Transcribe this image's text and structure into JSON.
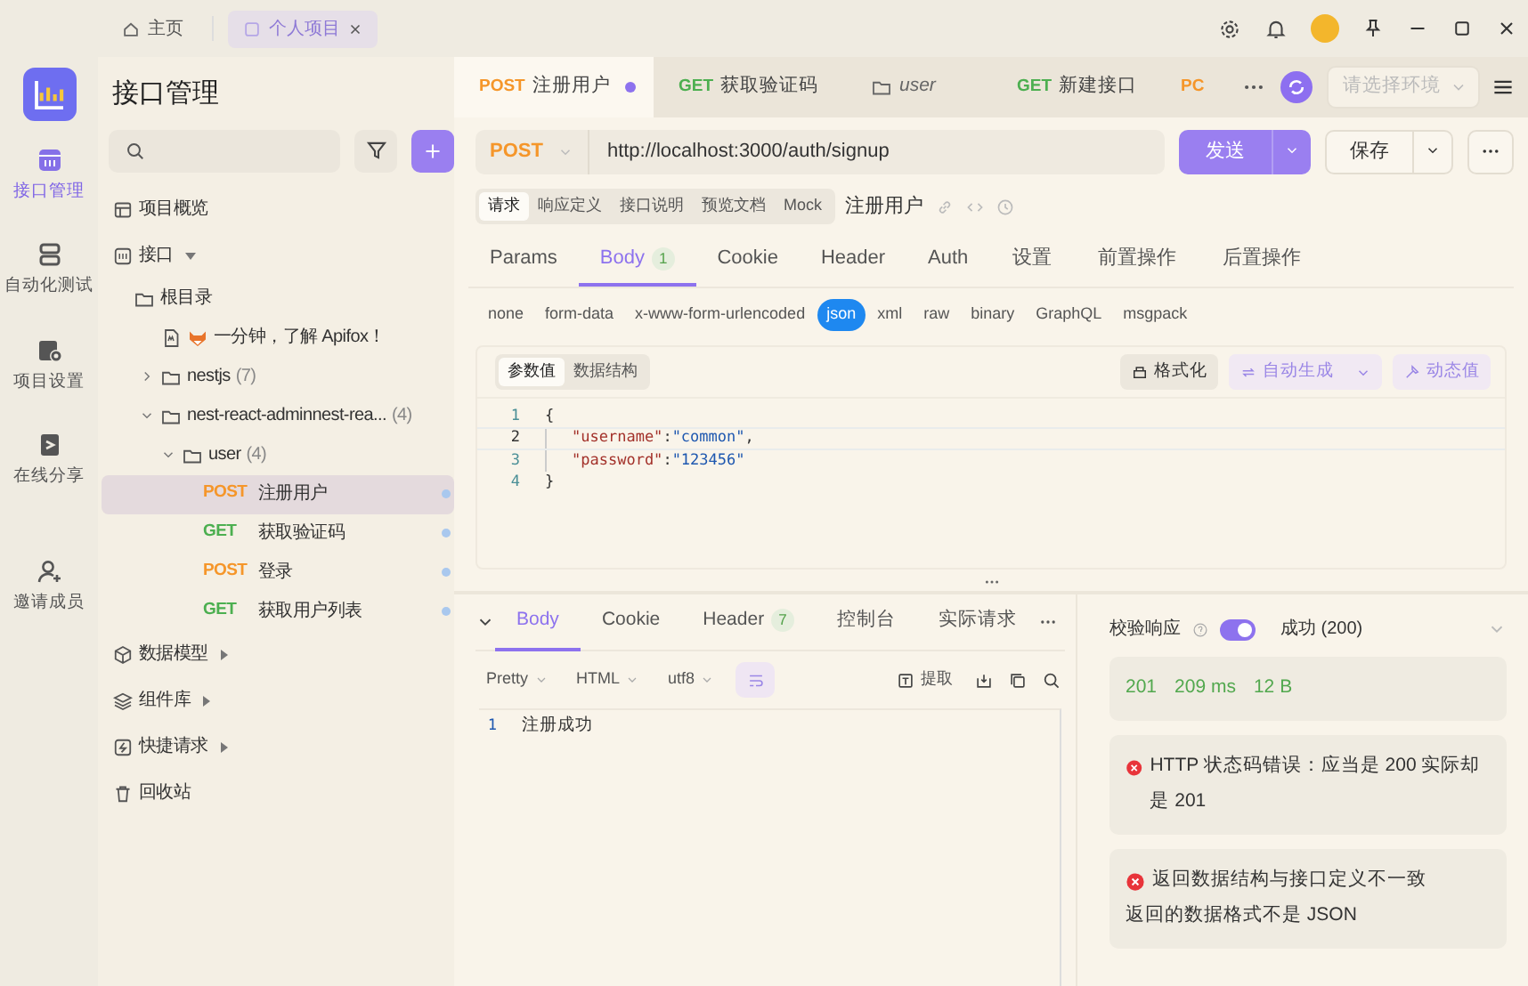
{
  "titlebar": {
    "tabs": [
      {
        "label": "主页",
        "kind": "home",
        "selected": false
      },
      {
        "label": "个人项目",
        "kind": "project",
        "selected": true
      }
    ]
  },
  "rail": [
    {
      "label": "接口管理",
      "kind": "api",
      "selected": true
    },
    {
      "label": "自动化测试",
      "kind": "test",
      "selected": false
    },
    {
      "label": "项目设置",
      "kind": "settings",
      "selected": false
    },
    {
      "label": "在线分享",
      "kind": "share",
      "selected": false
    },
    {
      "label": "邀请成员",
      "kind": "invite",
      "selected": false
    }
  ],
  "sidebar": {
    "title": "接口管理",
    "items": [
      {
        "label": "项目概览",
        "kind": "overview"
      },
      {
        "label": "接口",
        "kind": "api",
        "expanded": true,
        "children": [
          {
            "label": "根目录",
            "kind": "folder",
            "children": [
              {
                "label": "一分钟，了解 Apifox！",
                "kind": "doc"
              },
              {
                "label": "nestjs",
                "count": "(7)",
                "kind": "folder",
                "expanded": false
              },
              {
                "label": "nest-react-adminnest-rea...",
                "count": "(4)",
                "kind": "folder",
                "expanded": true,
                "children": [
                  {
                    "label": "user",
                    "count": "(4)",
                    "kind": "folder",
                    "expanded": true,
                    "children": [
                      {
                        "kind": "endpoint",
                        "method": "POST",
                        "color": "#f5962a",
                        "label": "注册用户",
                        "selected": true
                      },
                      {
                        "kind": "endpoint",
                        "method": "GET",
                        "color": "#4caf50",
                        "label": "获取验证码",
                        "selected": false
                      },
                      {
                        "kind": "endpoint",
                        "method": "POST",
                        "color": "#f5962a",
                        "label": "登录",
                        "selected": false
                      },
                      {
                        "kind": "endpoint",
                        "method": "GET",
                        "color": "#4caf50",
                        "label": "获取用户列表",
                        "selected": false
                      }
                    ]
                  }
                ]
              }
            ]
          }
        ]
      },
      {
        "label": "数据模型",
        "kind": "model",
        "expanded": false
      },
      {
        "label": "组件库",
        "kind": "components",
        "expanded": false
      },
      {
        "label": "快捷请求",
        "kind": "quick",
        "expanded": false
      },
      {
        "label": "回收站",
        "kind": "trash"
      }
    ]
  },
  "tabs": [
    {
      "method": "POST",
      "color": "#f5962a",
      "label": "注册用户",
      "selected": true,
      "modified": true
    },
    {
      "method": "GET",
      "color": "#4caf50",
      "label": "获取验证码",
      "selected": false,
      "modified": false
    },
    {
      "kind": "folder",
      "label": "user",
      "selected": false,
      "modified": false
    },
    {
      "method": "GET",
      "color": "#4caf50",
      "label": "新建接口",
      "selected": false,
      "modified": false
    },
    {
      "method": "PC",
      "color": "#f5962a",
      "selected": false,
      "modified": false
    }
  ],
  "environment": {
    "placeholder": "请选择环境"
  },
  "request": {
    "method": "POST",
    "url": "http://localhost:3000/auth/signup",
    "send": "发送",
    "save": "保存"
  },
  "sections": [
    {
      "label": "请求",
      "selected": true
    },
    {
      "label": "响应定义",
      "selected": false
    },
    {
      "label": "接口说明",
      "selected": false
    },
    {
      "label": "预览文档",
      "selected": false
    },
    {
      "label": "Mock",
      "selected": false
    }
  ],
  "endpoint_name": "注册用户",
  "param_tabs": [
    {
      "label": "Params",
      "selected": false
    },
    {
      "label": "Body",
      "badge": "1",
      "selected": true
    },
    {
      "label": "Cookie",
      "selected": false
    },
    {
      "label": "Header",
      "selected": false
    },
    {
      "label": "Auth",
      "selected": false
    },
    {
      "label": "设置",
      "selected": false
    },
    {
      "label": "前置操作",
      "selected": false
    },
    {
      "label": "后置操作",
      "selected": false
    }
  ],
  "body_types": [
    {
      "label": "none",
      "selected": false
    },
    {
      "label": "form-data",
      "selected": false
    },
    {
      "label": "x-www-form-urlencoded",
      "selected": false
    },
    {
      "label": "json",
      "selected": true
    },
    {
      "label": "xml",
      "selected": false
    },
    {
      "label": "raw",
      "selected": false
    },
    {
      "label": "binary",
      "selected": false
    },
    {
      "label": "GraphQL",
      "selected": false
    },
    {
      "label": "msgpack",
      "selected": false
    }
  ],
  "editor": {
    "modes": [
      {
        "label": "参数值",
        "selected": true
      },
      {
        "label": "数据结构",
        "selected": false
      }
    ],
    "actions": [
      {
        "label": "格式化",
        "kind": "format"
      },
      {
        "label": "自动生成",
        "kind": "generate"
      },
      {
        "label": "动态值",
        "kind": "dynamic"
      }
    ],
    "lines": [
      {
        "number": "1",
        "current": false,
        "nested": false,
        "tokens": [
          {
            "kind": "punct",
            "text": "{"
          }
        ]
      },
      {
        "number": "2",
        "current": true,
        "nested": true,
        "tokens": [
          {
            "kind": "key",
            "text": "\"username\""
          },
          {
            "kind": "punct",
            "text": ":"
          },
          {
            "kind": "value",
            "text": "\"common\""
          },
          {
            "kind": "punct",
            "text": ","
          }
        ]
      },
      {
        "number": "3",
        "current": false,
        "nested": true,
        "tokens": [
          {
            "kind": "key",
            "text": "\"password\""
          },
          {
            "kind": "punct",
            "text": ":"
          },
          {
            "kind": "value",
            "text": "\"123456\""
          }
        ]
      },
      {
        "number": "4",
        "current": false,
        "nested": false,
        "tokens": [
          {
            "kind": "punct",
            "text": "}"
          }
        ]
      }
    ]
  },
  "response": {
    "tabs": [
      {
        "label": "Body",
        "selected": true
      },
      {
        "label": "Cookie",
        "selected": false
      },
      {
        "label": "Header",
        "badge": "7",
        "selected": false
      },
      {
        "label": "控制台",
        "selected": false
      },
      {
        "label": "实际请求",
        "selected": false
      }
    ],
    "selects": [
      {
        "label": "Pretty"
      },
      {
        "label": "HTML"
      },
      {
        "label": "utf8"
      }
    ],
    "extract": "提取",
    "lines": [
      {
        "number": "1",
        "text": "注册成功"
      }
    ]
  },
  "validation": {
    "label": "校验响应",
    "enabled": true,
    "result": "成功 (200)",
    "stats": [
      "201",
      "209 ms",
      "12 B"
    ],
    "errors": [
      {
        "title": "HTTP 状态码错误：应当是 200 实际却是 201"
      },
      {
        "title": "返回数据结构与接口定义不一致",
        "detail": "返回的数据格式不是 JSON"
      }
    ]
  }
}
